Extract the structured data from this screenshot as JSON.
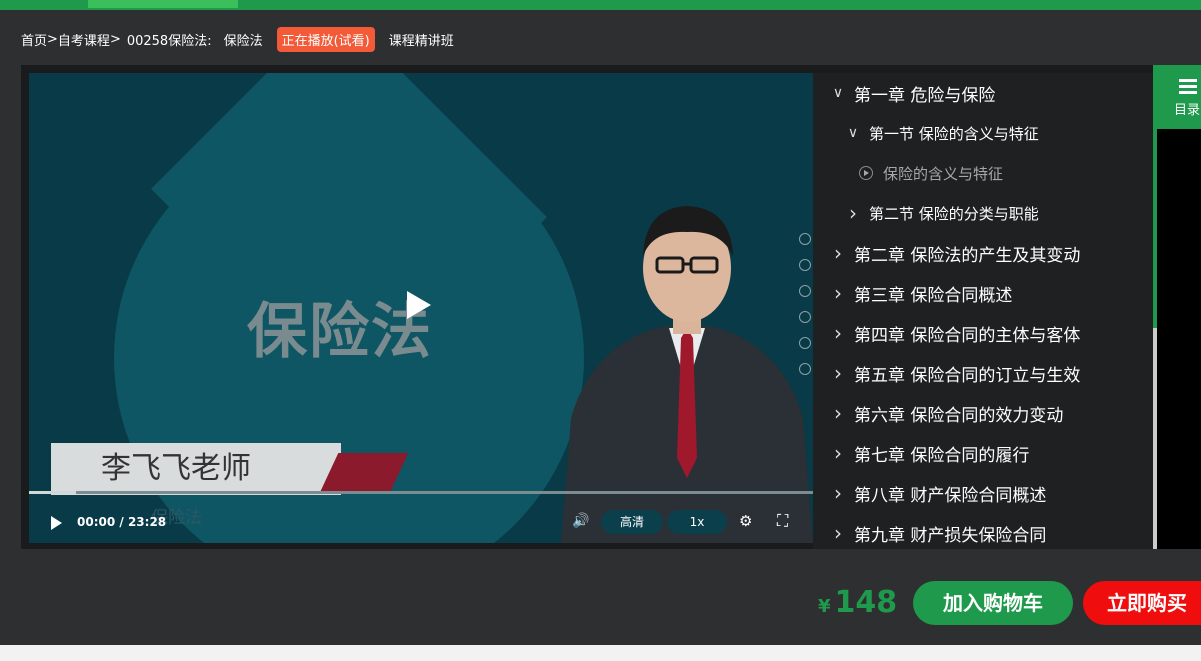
{
  "breadcrumb": {
    "home": "首页",
    "sep1": ">",
    "courses": "自考课程",
    "sep2": ">",
    "course_code": "00258保险法:",
    "course_name": "保险法",
    "status_badge": "正在播放(试看)",
    "class_type": "课程精讲班"
  },
  "video": {
    "slide_title": "保险法",
    "teacher_name": "李飞飞老师",
    "subtitle_text": "保险法",
    "time_current": "00:00",
    "time_sep": " / ",
    "time_total": "23:28",
    "progress_fraction": 0.06,
    "quality_label": "高清",
    "rate_label": "1x",
    "controls_icons": [
      "play-icon",
      "volume-icon",
      "gear-icon",
      "fullscreen-icon"
    ]
  },
  "toc": {
    "tab_label": "目录",
    "items": [
      {
        "level": 1,
        "expanded": true,
        "label": "第一章 危险与保险"
      },
      {
        "level": 2,
        "expanded": true,
        "label": "第一节 保险的含义与特征"
      },
      {
        "level": 3,
        "label": "保险的含义与特征"
      },
      {
        "level": 2,
        "expanded": false,
        "label": "第二节 保险的分类与职能"
      },
      {
        "level": 1,
        "expanded": false,
        "label": "第二章 保险法的产生及其变动"
      },
      {
        "level": 1,
        "expanded": false,
        "label": "第三章 保险合同概述"
      },
      {
        "level": 1,
        "expanded": false,
        "label": "第四章 保险合同的主体与客体"
      },
      {
        "level": 1,
        "expanded": false,
        "label": "第五章 保险合同的订立与生效"
      },
      {
        "level": 1,
        "expanded": false,
        "label": "第六章 保险合同的效力变动"
      },
      {
        "level": 1,
        "expanded": false,
        "label": "第七章 保险合同的履行"
      },
      {
        "level": 1,
        "expanded": false,
        "label": "第八章 财产保险合同概述"
      },
      {
        "level": 1,
        "expanded": false,
        "label": "第九章 财产损失保险合同"
      }
    ]
  },
  "purchase": {
    "currency": "¥",
    "price": "148",
    "add_to_cart": "加入购物车",
    "buy_now": "立即购买"
  },
  "colors": {
    "brand_green": "#1f9a4c",
    "badge_orange": "#f25a38",
    "buy_red": "#f00d0d"
  }
}
